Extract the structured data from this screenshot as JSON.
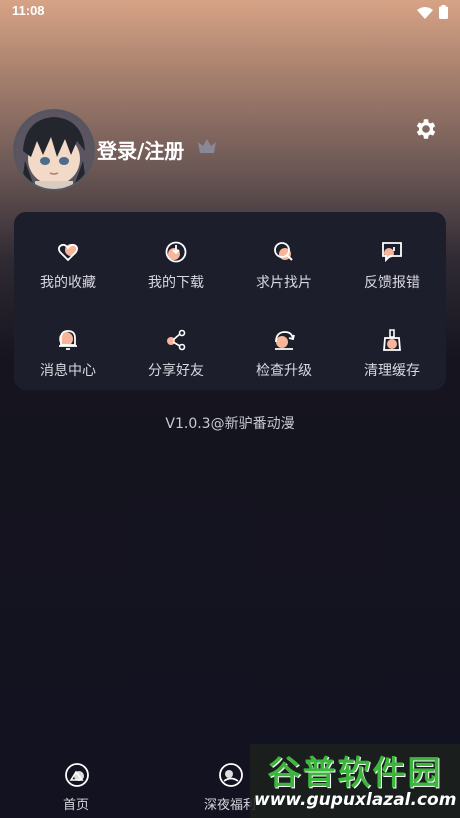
{
  "status_bar": {
    "time": "11:08",
    "icons": [
      "wifi-icon",
      "battery-icon"
    ]
  },
  "profile": {
    "login_label": "登录/注册",
    "avatar_icon": "anime-avatar",
    "crown_icon": "crown-icon",
    "settings_icon": "gear-icon"
  },
  "menu": {
    "items": [
      {
        "label": "我的收藏",
        "icon": "heart-icon"
      },
      {
        "label": "我的下载",
        "icon": "download-icon"
      },
      {
        "label": "求片找片",
        "icon": "search-film-icon"
      },
      {
        "label": "反馈报错",
        "icon": "feedback-icon"
      },
      {
        "label": "消息中心",
        "icon": "bell-icon"
      },
      {
        "label": "分享好友",
        "icon": "share-icon"
      },
      {
        "label": "检查升级",
        "icon": "refresh-icon"
      },
      {
        "label": "清理缓存",
        "icon": "broom-icon"
      }
    ]
  },
  "version_text": "V1.0.3@新驴番动漫",
  "bottom_nav": {
    "items": [
      {
        "label": "首页",
        "icon": "home-icon"
      },
      {
        "label": "深夜福利",
        "icon": "moon-icon"
      }
    ]
  },
  "watermark": {
    "title": "谷普软件园",
    "url": "www.gupuxlazal.com"
  },
  "colors": {
    "accent": "#f7b59a",
    "card_bg": "#1d1e2b",
    "page_bg": "#121220"
  }
}
